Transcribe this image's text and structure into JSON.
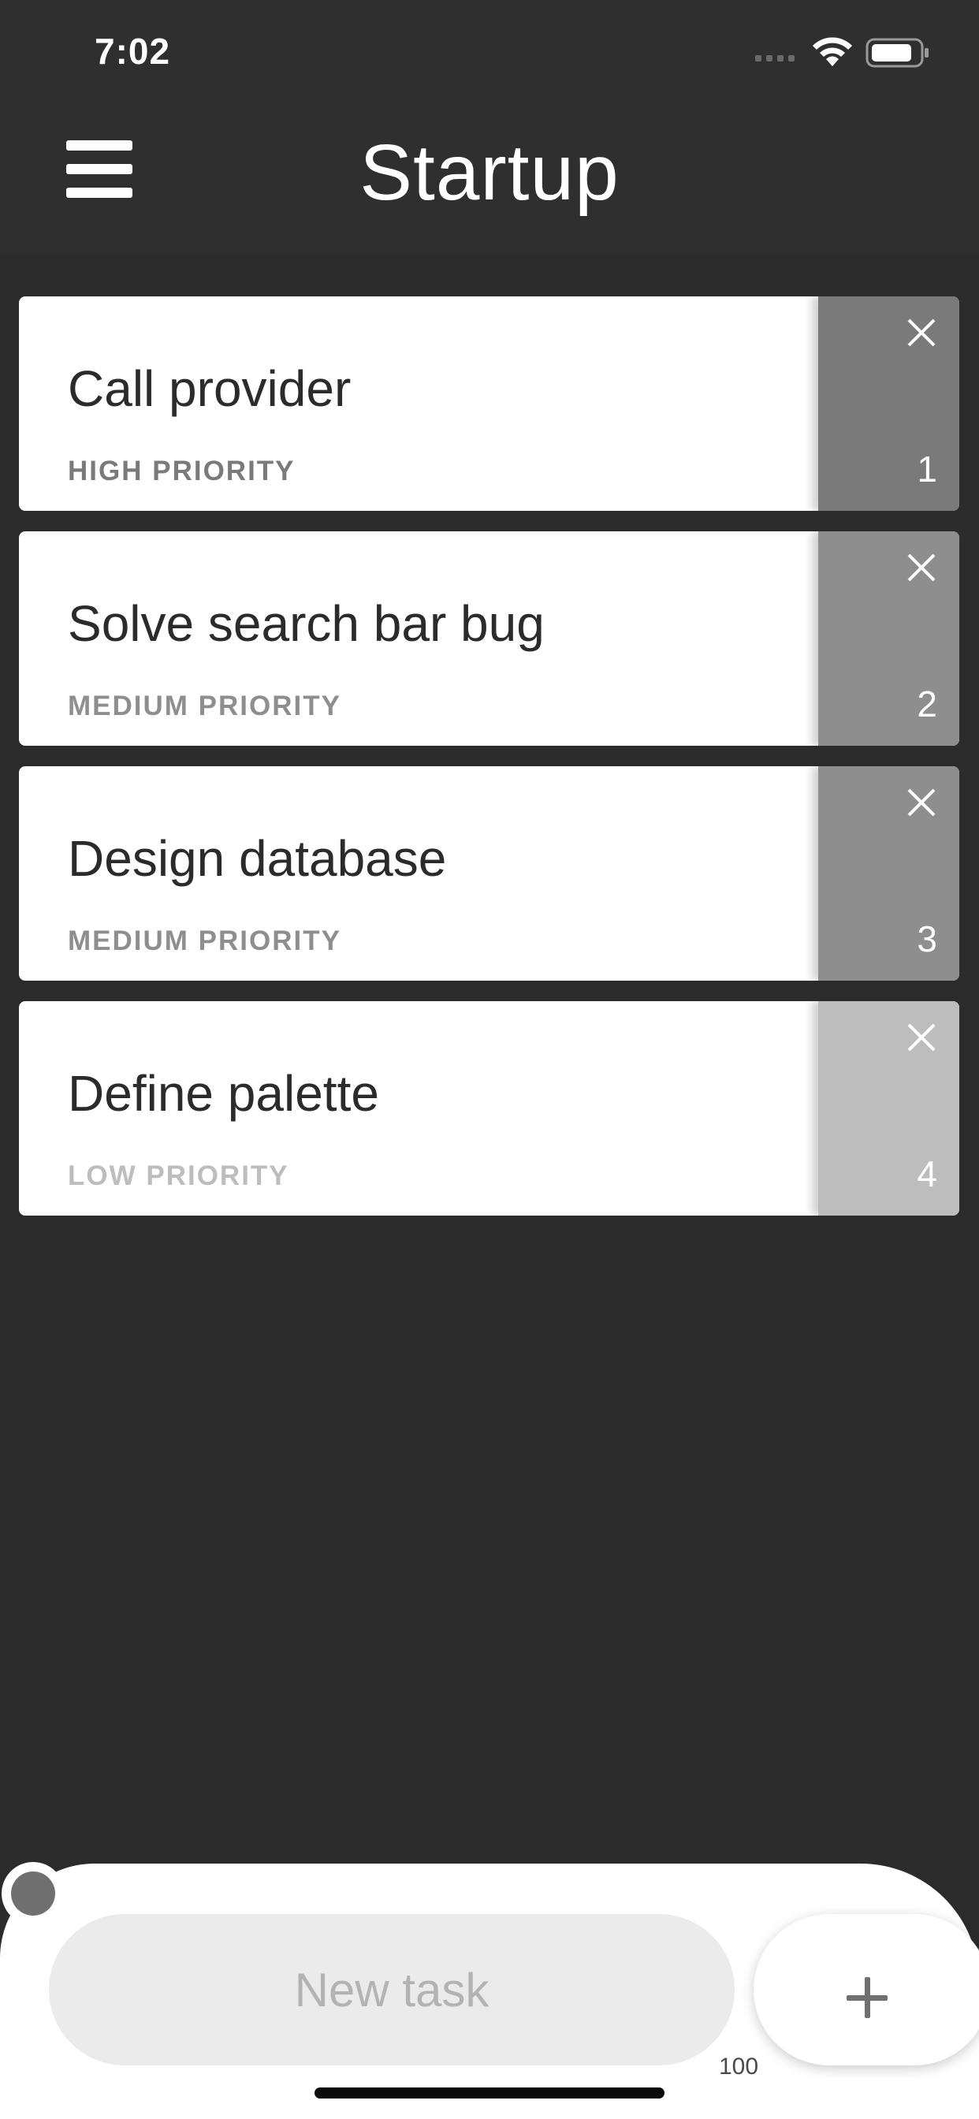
{
  "status_bar": {
    "time": "7:02",
    "icons": [
      "signal-dots-icon",
      "wifi-icon",
      "battery-icon"
    ]
  },
  "header": {
    "title": "Startup",
    "menu_icon": "hamburger-menu-icon"
  },
  "tasks": [
    {
      "title": "Call provider",
      "priority": "HIGH PRIORITY",
      "number": "1",
      "priority_color": "#7a7a7a",
      "side_color": "#7a7a7a"
    },
    {
      "title": "Solve search bar bug",
      "priority": "MEDIUM PRIORITY",
      "number": "2",
      "priority_color": "#8e8e8e",
      "side_color": "#8e8e8e"
    },
    {
      "title": "Design database",
      "priority": "MEDIUM PRIORITY",
      "number": "3",
      "priority_color": "#8e8e8e",
      "side_color": "#8e8e8e"
    },
    {
      "title": "Define palette",
      "priority": "LOW PRIORITY",
      "number": "4",
      "priority_color": "#bdbdbd",
      "side_color": "#bdbdbd"
    }
  ],
  "composer": {
    "placeholder": "New task",
    "value": "",
    "counter": "100",
    "add_icon": "plus-icon"
  },
  "colors": {
    "background": "#2b2b2b",
    "header": "#2f2f2f",
    "card": "#ffffff",
    "input": "#ebebeb"
  }
}
